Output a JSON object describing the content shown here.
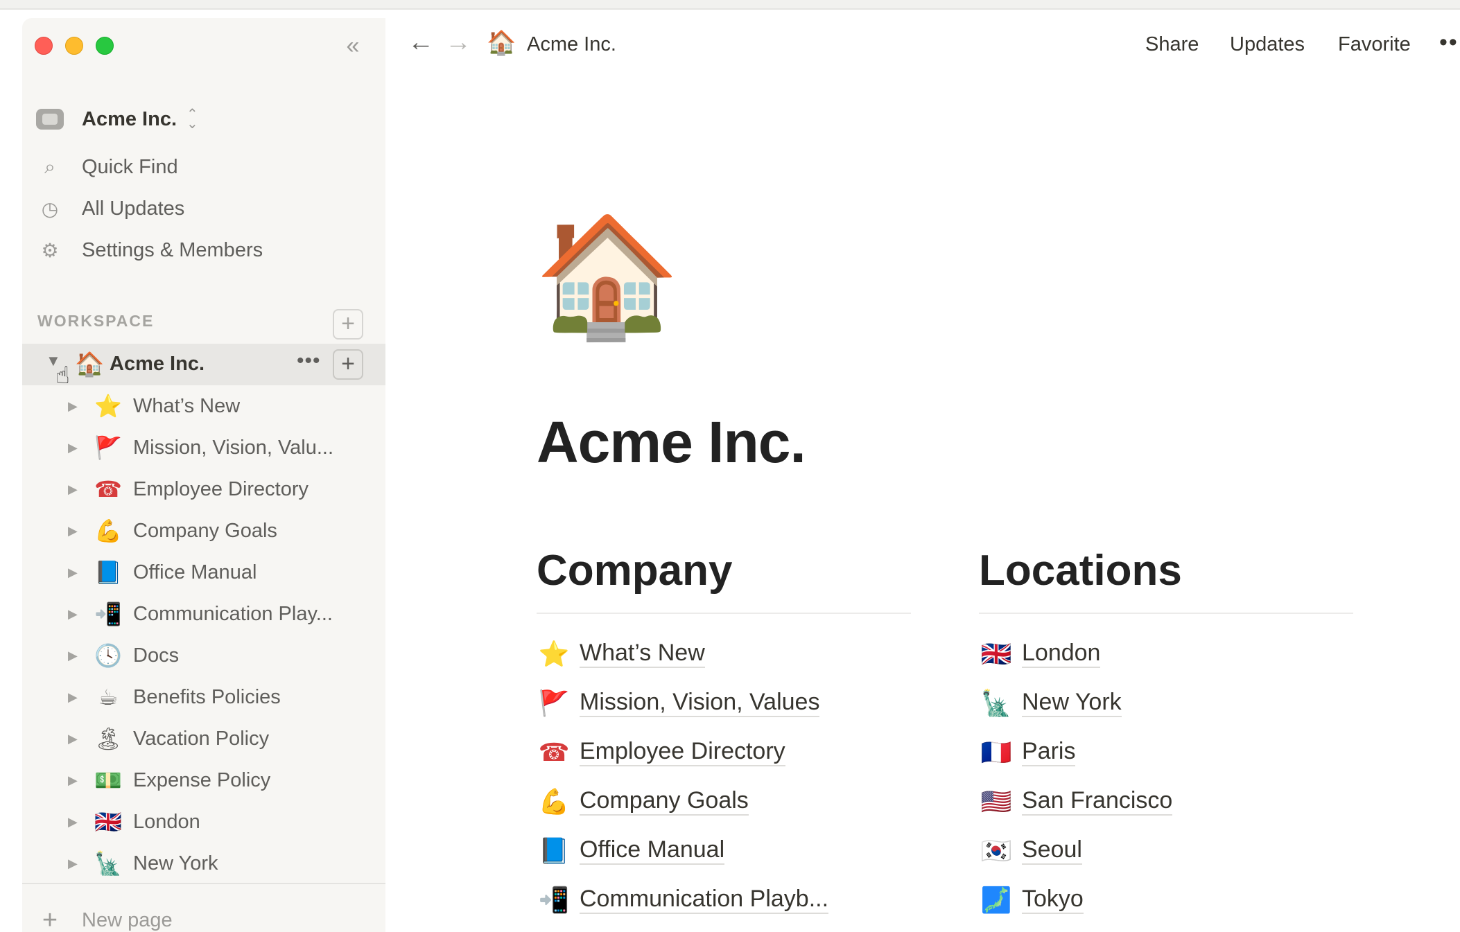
{
  "window": {
    "traffic_lights": {
      "close": "#ff5f57",
      "minimize": "#febc2e",
      "zoom": "#28c840"
    },
    "collapse_icon": "«"
  },
  "sidebar": {
    "workspace_name": "Acme Inc.",
    "workspace_switch_icon": "⌃⌄",
    "nav": [
      {
        "label": "Quick Find",
        "icon": "⌕"
      },
      {
        "label": "All Updates",
        "icon": "◷"
      },
      {
        "label": "Settings & Members",
        "icon": "⚙"
      }
    ],
    "section_label": "WORKSPACE",
    "section_add": "+",
    "active_page": {
      "label": "Acme Inc.",
      "emoji": "🏠",
      "toggle": "▼",
      "more": "•••",
      "add": "+"
    },
    "pages": [
      {
        "label": "What’s New",
        "emoji": "⭐"
      },
      {
        "label": "Mission, Vision, Valu...",
        "emoji": "🚩"
      },
      {
        "label": "Employee Directory",
        "emoji": "☎"
      },
      {
        "label": "Company Goals",
        "emoji": "💪"
      },
      {
        "label": "Office Manual",
        "emoji": "📘"
      },
      {
        "label": "Communication Play...",
        "emoji": "📲"
      },
      {
        "label": "Docs",
        "emoji": "🕓"
      },
      {
        "label": "Benefits Policies",
        "emoji": "☕"
      },
      {
        "label": "Vacation Policy",
        "emoji": "🏝"
      },
      {
        "label": "Expense Policy",
        "emoji": "💵"
      },
      {
        "label": "London",
        "emoji": "🇬🇧"
      },
      {
        "label": "New York",
        "emoji": "🗽"
      }
    ],
    "new_page": {
      "label": "New page",
      "icon": "+"
    }
  },
  "topbar": {
    "back_icon": "←",
    "forward_icon": "→",
    "breadcrumb": {
      "label": "Acme Inc.",
      "emoji": "🏠"
    },
    "actions": {
      "share": "Share",
      "updates": "Updates",
      "favorite": "Favorite",
      "more": "••"
    }
  },
  "page": {
    "icon": "🏠",
    "title": "Acme Inc.",
    "columns": [
      {
        "heading": "Company",
        "links": [
          {
            "label": "What’s New",
            "emoji": "⭐"
          },
          {
            "label": "Mission, Vision, Values",
            "emoji": "🚩"
          },
          {
            "label": "Employee Directory",
            "emoji": "☎"
          },
          {
            "label": "Company Goals",
            "emoji": "💪"
          },
          {
            "label": "Office Manual",
            "emoji": "📘"
          },
          {
            "label": "Communication Playb...",
            "emoji": "📲"
          }
        ]
      },
      {
        "heading": "Locations",
        "links": [
          {
            "label": "London",
            "emoji": "🇬🇧"
          },
          {
            "label": "New York",
            "emoji": "🗽"
          },
          {
            "label": "Paris",
            "emoji": "🇫🇷"
          },
          {
            "label": "San Francisco",
            "emoji": "🇺🇸"
          },
          {
            "label": "Seoul",
            "emoji": "🇰🇷"
          },
          {
            "label": "Tokyo",
            "emoji": "🗾"
          }
        ]
      }
    ]
  }
}
